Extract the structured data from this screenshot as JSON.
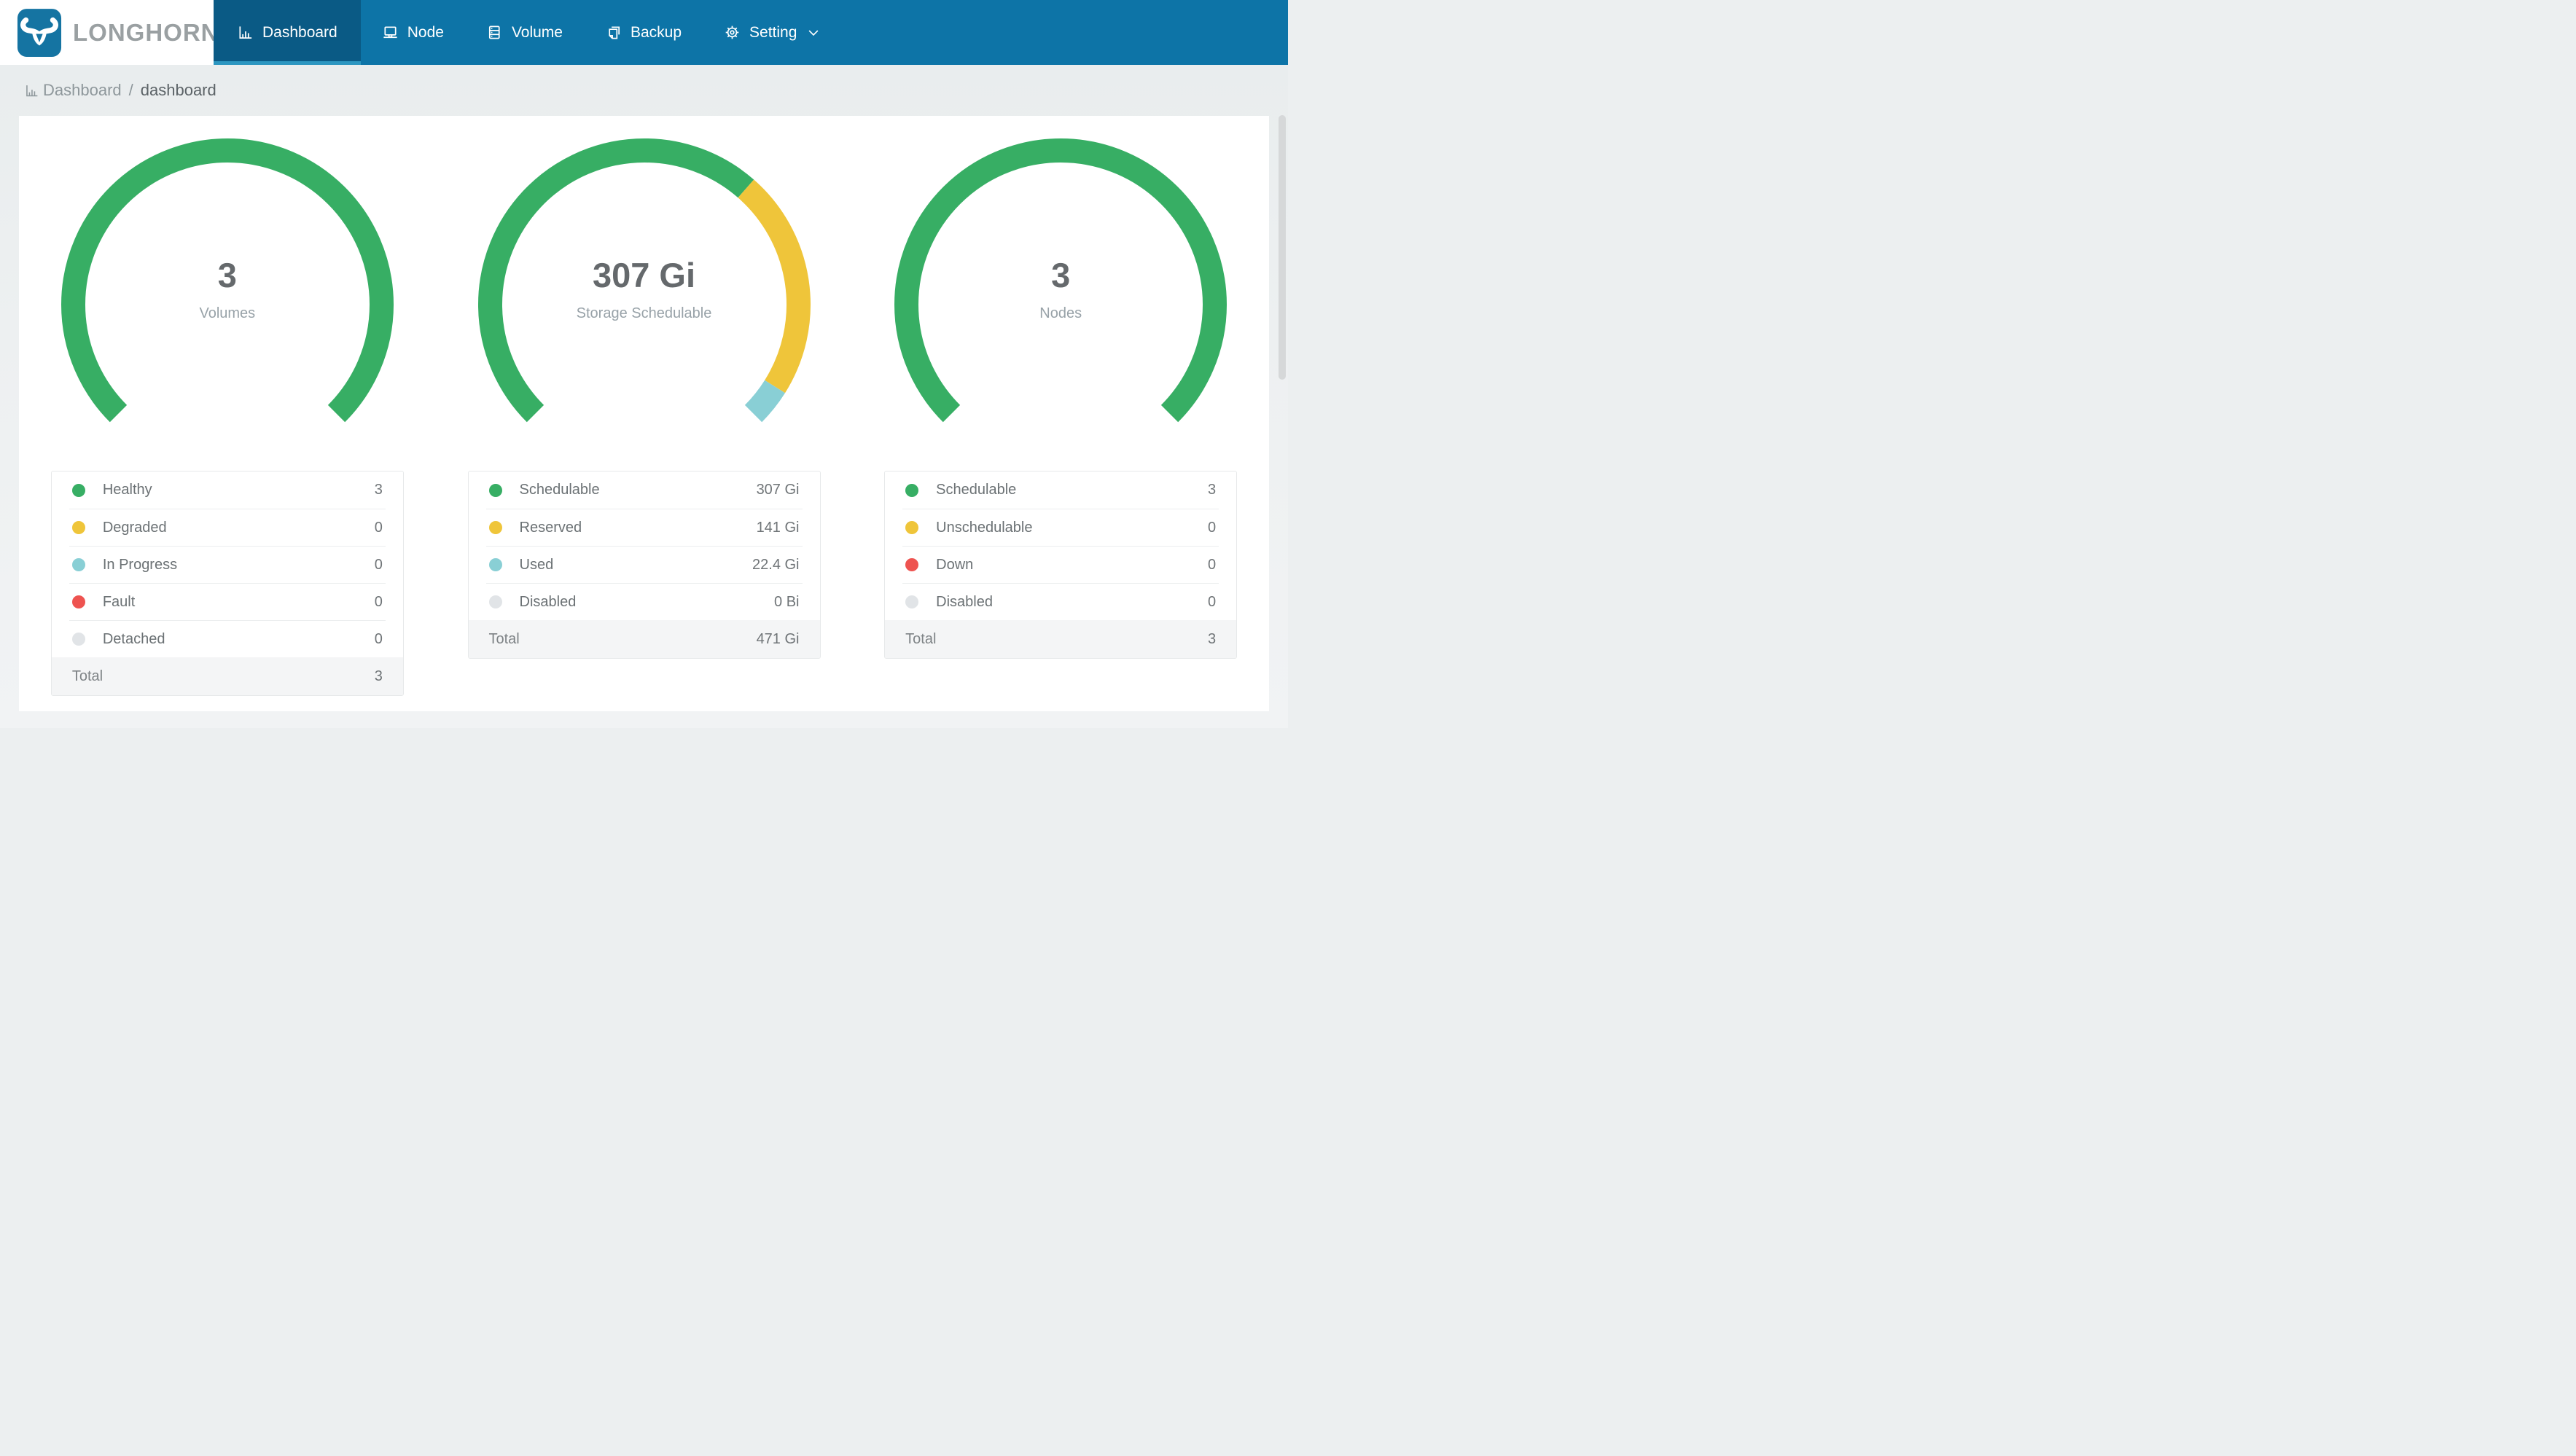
{
  "brand": {
    "name": "LONGHORN"
  },
  "navbar": {
    "items": [
      {
        "label": "Dashboard",
        "icon": "bar-chart-icon",
        "active": true
      },
      {
        "label": "Node",
        "icon": "laptop-icon",
        "active": false
      },
      {
        "label": "Volume",
        "icon": "database-icon",
        "active": false
      },
      {
        "label": "Backup",
        "icon": "copy-icon",
        "active": false
      },
      {
        "label": "Setting",
        "icon": "gear-icon",
        "active": false,
        "has_dropdown": true
      }
    ]
  },
  "breadcrumb": {
    "section": "Dashboard",
    "separator": "/",
    "page": "dashboard"
  },
  "colors": {
    "navbar": "#0d74a7",
    "navbar_active": "#0a5a85",
    "navbar_active_underline": "#2c96c0",
    "logo_tile": "#1574a2",
    "healthy_green": "#37ae64",
    "warning_yellow": "#efc53a",
    "progress_teal": "#89cfd5",
    "fault_red": "#ee5350",
    "disabled_gray": "#e1e4e7"
  },
  "chart_data": [
    {
      "type": "donut-gauge",
      "center_value": "3",
      "center_label": "Volumes",
      "start_angle": 135,
      "sweep_angle": 270,
      "items": [
        {
          "label": "Healthy",
          "value": 3,
          "display": "3",
          "color": "#37ae64"
        },
        {
          "label": "Degraded",
          "value": 0,
          "display": "0",
          "color": "#efc53a"
        },
        {
          "label": "In Progress",
          "value": 0,
          "display": "0",
          "color": "#89cfd5"
        },
        {
          "label": "Fault",
          "value": 0,
          "display": "0",
          "color": "#ee5350"
        },
        {
          "label": "Detached",
          "value": 0,
          "display": "0",
          "color": "#e1e4e7"
        }
      ],
      "total_label": "Total",
      "total_display": "3"
    },
    {
      "type": "donut-gauge",
      "center_value": "307 Gi",
      "center_label": "Storage Schedulable",
      "start_angle": 135,
      "sweep_angle": 270,
      "items": [
        {
          "label": "Schedulable",
          "value": 307,
          "display": "307 Gi",
          "color": "#37ae64"
        },
        {
          "label": "Reserved",
          "value": 141,
          "display": "141 Gi",
          "color": "#efc53a"
        },
        {
          "label": "Used",
          "value": 22.4,
          "display": "22.4 Gi",
          "color": "#89cfd5"
        },
        {
          "label": "Disabled",
          "value": 0,
          "display": "0 Bi",
          "color": "#e1e4e7"
        }
      ],
      "total_label": "Total",
      "total_display": "471 Gi"
    },
    {
      "type": "donut-gauge",
      "center_value": "3",
      "center_label": "Nodes",
      "start_angle": 135,
      "sweep_angle": 270,
      "items": [
        {
          "label": "Schedulable",
          "value": 3,
          "display": "3",
          "color": "#37ae64"
        },
        {
          "label": "Unschedulable",
          "value": 0,
          "display": "0",
          "color": "#efc53a"
        },
        {
          "label": "Down",
          "value": 0,
          "display": "0",
          "color": "#ee5350"
        },
        {
          "label": "Disabled",
          "value": 0,
          "display": "0",
          "color": "#e1e4e7"
        }
      ],
      "total_label": "Total",
      "total_display": "3"
    }
  ]
}
